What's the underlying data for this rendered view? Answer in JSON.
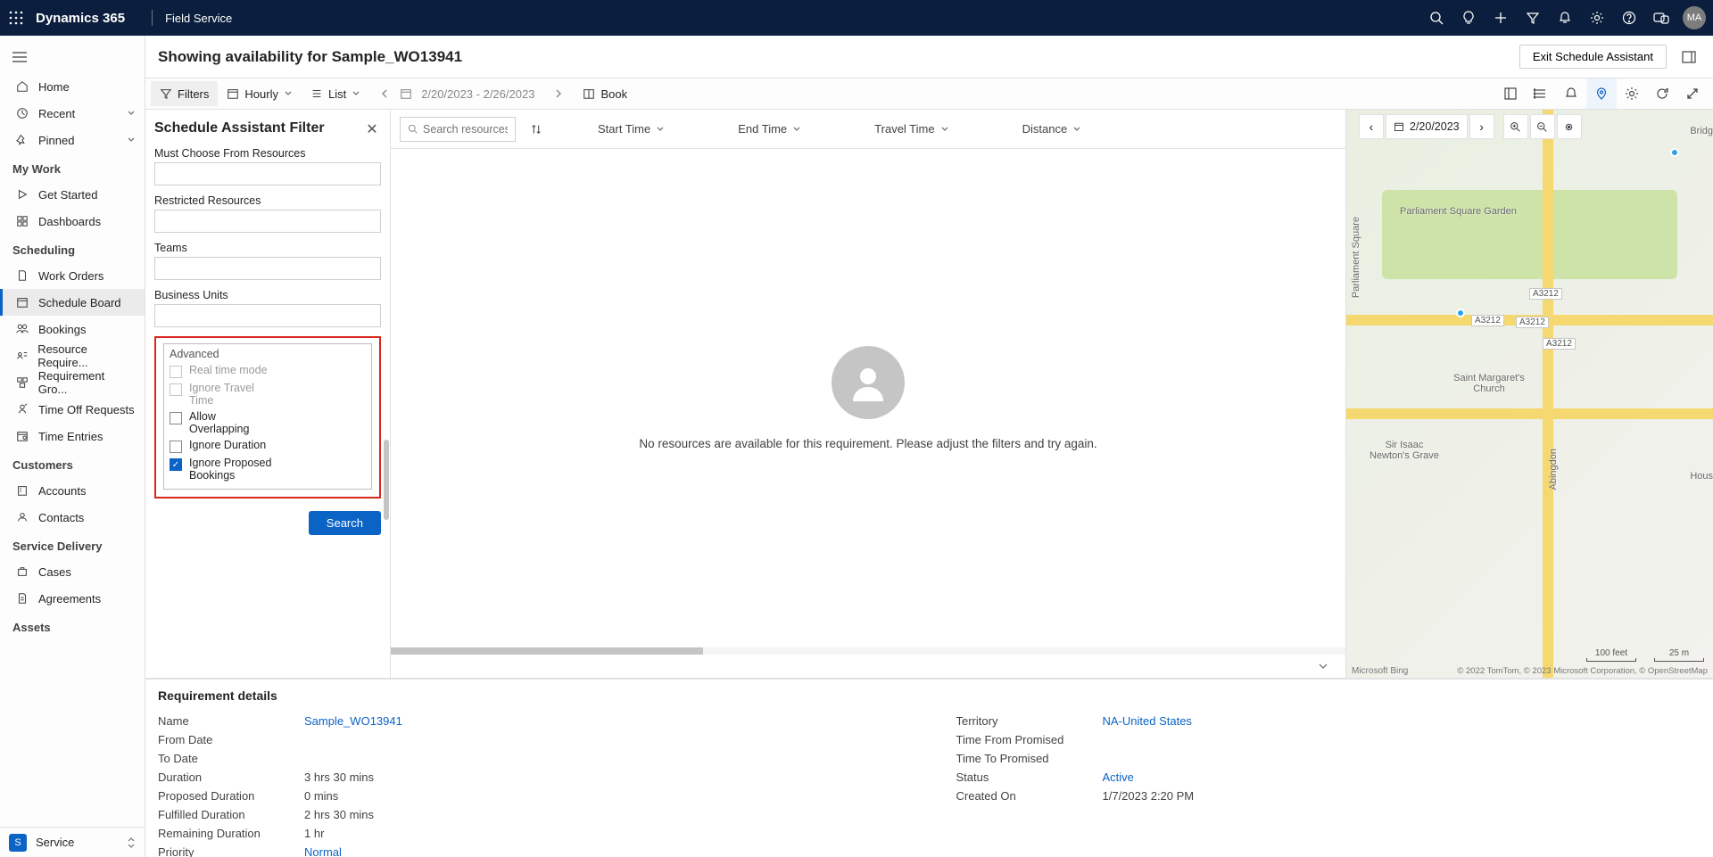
{
  "topbar": {
    "brand": "Dynamics 365",
    "app_name": "Field Service",
    "avatar": "MA"
  },
  "page": {
    "title": "Showing availability for Sample_WO13941",
    "exit_btn": "Exit Schedule Assistant"
  },
  "sidebar": {
    "items_top": [
      {
        "icon": "home",
        "label": "Home"
      },
      {
        "icon": "clock",
        "label": "Recent",
        "chevron": true
      },
      {
        "icon": "pin",
        "label": "Pinned",
        "chevron": true
      }
    ],
    "groups": [
      {
        "title": "My Work",
        "items": [
          {
            "icon": "play",
            "label": "Get Started"
          },
          {
            "icon": "dashboard",
            "label": "Dashboards"
          }
        ]
      },
      {
        "title": "Scheduling",
        "items": [
          {
            "icon": "doc",
            "label": "Work Orders"
          },
          {
            "icon": "calendar",
            "label": "Schedule Board",
            "active": true
          },
          {
            "icon": "people",
            "label": "Bookings"
          },
          {
            "icon": "req",
            "label": "Resource Require..."
          },
          {
            "icon": "group",
            "label": "Requirement Gro..."
          },
          {
            "icon": "timeoff",
            "label": "Time Off Requests"
          },
          {
            "icon": "timesheet",
            "label": "Time Entries"
          }
        ]
      },
      {
        "title": "Customers",
        "items": [
          {
            "icon": "account",
            "label": "Accounts"
          },
          {
            "icon": "contact",
            "label": "Contacts"
          }
        ]
      },
      {
        "title": "Service Delivery",
        "items": [
          {
            "icon": "case",
            "label": "Cases"
          },
          {
            "icon": "agreement",
            "label": "Agreements"
          }
        ]
      },
      {
        "title": "Assets",
        "items": []
      }
    ],
    "switcher": {
      "badge": "S",
      "label": "Service"
    }
  },
  "toolbar": {
    "filters": "Filters",
    "hourly": "Hourly",
    "list": "List",
    "date_range": "2/20/2023 - 2/26/2023",
    "book": "Book"
  },
  "filter_panel": {
    "title": "Schedule Assistant Filter",
    "f_must": "Must Choose From Resources",
    "f_restricted": "Restricted Resources",
    "f_teams": "Teams",
    "f_bu": "Business Units",
    "advanced": "Advanced",
    "chk_realtime": "Real time mode",
    "chk_ignore_travel": "Ignore Travel Time",
    "chk_overlap": "Allow Overlapping",
    "chk_ignore_dur": "Ignore Duration",
    "chk_ignore_prop": "Ignore Proposed Bookings",
    "search_btn": "Search"
  },
  "grid": {
    "search_placeholder": "Search resources",
    "col_start": "Start Time",
    "col_end": "End Time",
    "col_travel": "Travel Time",
    "col_distance": "Distance",
    "empty_msg": "No resources are available for this requirement. Please adjust the filters and try again."
  },
  "map": {
    "date": "2/20/2023",
    "labels": {
      "parl_sq": "Parliament Square",
      "garden": "Parliament Square Garden",
      "church": "Saint Margaret's Church",
      "newtons": "Sir Isaac\nNewton's Grave",
      "bridge": "Bridg",
      "hous": "Hous",
      "abingdon": "Abingdon"
    },
    "road_tags": [
      "A3212",
      "A3212",
      "A3212",
      "A3212"
    ],
    "scale_ft": "100 feet",
    "scale_m": "25 m",
    "attr_l": "Microsoft Bing",
    "attr_r": "© 2022 TomTom, © 2023 Microsoft Corporation, © OpenStreetMap"
  },
  "details": {
    "title": "Requirement details",
    "left": [
      {
        "l": "Name",
        "v": "Sample_WO13941",
        "link": true
      },
      {
        "l": "From Date",
        "v": ""
      },
      {
        "l": "To Date",
        "v": ""
      },
      {
        "l": "Duration",
        "v": "3 hrs 30 mins"
      },
      {
        "l": "Proposed Duration",
        "v": "0 mins"
      },
      {
        "l": "Fulfilled Duration",
        "v": "2 hrs 30 mins"
      },
      {
        "l": "Remaining Duration",
        "v": "1 hr"
      },
      {
        "l": "Priority",
        "v": "Normal",
        "link": true
      }
    ],
    "right": [
      {
        "l": "Territory",
        "v": "NA-United States",
        "link": true
      },
      {
        "l": "Time From Promised",
        "v": ""
      },
      {
        "l": "Time To Promised",
        "v": ""
      },
      {
        "l": "Status",
        "v": "Active",
        "link": true
      },
      {
        "l": "Created On",
        "v": "1/7/2023 2:20 PM"
      }
    ]
  }
}
